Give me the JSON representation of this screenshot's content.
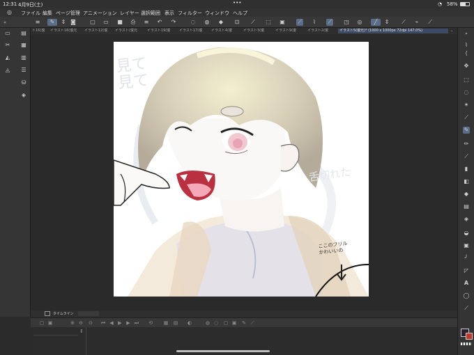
{
  "status": {
    "time": "12:31",
    "date": "4月9日(土)",
    "dots": "•••",
    "battery": "58%"
  },
  "menu": [
    "ファイル",
    "編集",
    "ページ管理",
    "アニメーション",
    "レイヤー",
    "選択範囲",
    "表示",
    "フィルター",
    "ウィンドウ",
    "ヘルプ"
  ],
  "tabs": [
    {
      "label": "ト16(復"
    },
    {
      "label": "イラスト16(復元"
    },
    {
      "label": "イラスト12(復"
    },
    {
      "label": "イラスト(復元"
    },
    {
      "label": "イラスト19(復"
    },
    {
      "label": "イラスト17(復"
    },
    {
      "label": "イラスト4(復"
    },
    {
      "label": "イラスト3(復"
    },
    {
      "label": "イラスト9(復"
    },
    {
      "label": "イラスト2(復"
    },
    {
      "label": "イラスト5(復元)* (1000 x 1000px 72dpi 147.0%)"
    }
  ],
  "artwork": {
    "text_top_left": "見て見て",
    "text_right": "舌切れた",
    "annotation": "ここのフリル\nかわいいの"
  },
  "timeline": {
    "label": "タイムライン"
  },
  "colors": {
    "accent": "#5a6e8a",
    "panel": "#353535",
    "canvas_bg": "#2a2a2a",
    "main_color": "#2a2030",
    "sub_color": "#c0392b"
  },
  "icons": {
    "toolbar": [
      "menu-icon",
      "pen-sel-icon",
      "updown-icon",
      "camera-icon",
      "new-file-icon",
      "open-icon",
      "color-swatch-icon",
      "print-icon",
      "undo-icon",
      "redo-icon",
      "fill-icon",
      "lasso-icon",
      "eraser-icon",
      "transform-icon",
      "bucket-icon",
      "select-icon",
      "crop-icon",
      "grid-icon",
      "ruler-icon",
      "stabilizer-icon",
      "sync-icon",
      "brush-icon",
      "updown-icon"
    ],
    "right": [
      "hand-icon",
      "zoom-icon",
      "move-icon",
      "lasso-icon",
      "wand-icon",
      "eyedropper-icon",
      "pen-icon",
      "pencil-icon",
      "brush-icon",
      "airbrush-icon",
      "blend-icon",
      "eraser-icon",
      "fill-icon",
      "gradient-icon",
      "shape-icon",
      "frame-icon",
      "ruler-icon",
      "text-icon",
      "balloon-icon",
      "correction-icon"
    ]
  }
}
